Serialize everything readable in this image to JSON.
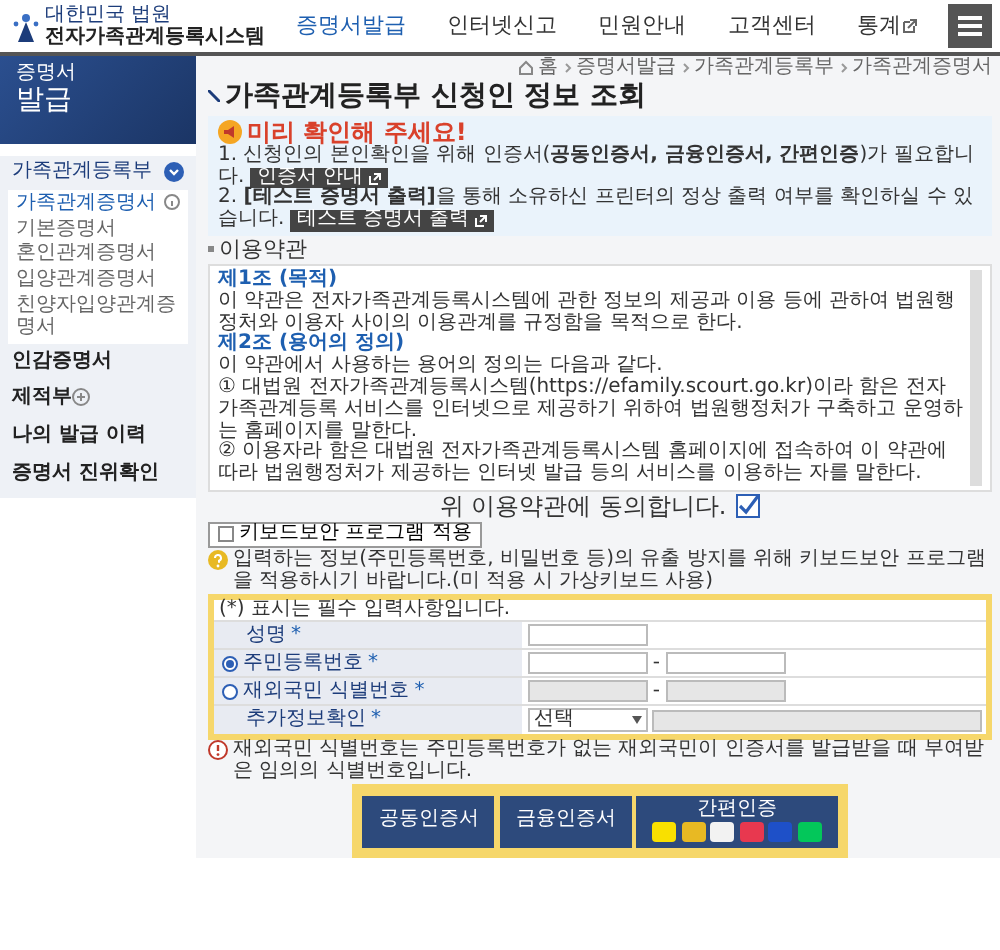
{
  "header": {
    "logo_top": "대한민국 법원",
    "logo_name": "전자가족관계등록시스템",
    "nav": [
      {
        "label": "증명서발급",
        "selected": true,
        "external": false
      },
      {
        "label": "인터넷신고",
        "selected": false,
        "external": false
      },
      {
        "label": "민원안내",
        "selected": false,
        "external": false
      },
      {
        "label": "고객센터",
        "selected": false,
        "external": false
      },
      {
        "label": "통계",
        "selected": false,
        "external": true
      }
    ]
  },
  "sidebar": {
    "banner_small": "증명서",
    "banner_large": "발급",
    "items": [
      {
        "kind": "group",
        "label": "가족관계등록부",
        "expanded": true,
        "children": [
          {
            "label": "가족관계증명서",
            "selected": true
          },
          {
            "label": "기본증명서",
            "selected": false
          },
          {
            "label": "혼인관계증명서",
            "selected": false
          },
          {
            "label": "입양관계증명서",
            "selected": false
          },
          {
            "label": "친양자입양관계증명서",
            "selected": false
          }
        ]
      },
      {
        "kind": "link",
        "label": "인감증명서"
      },
      {
        "kind": "group",
        "label": "제적부",
        "expanded": false
      },
      {
        "kind": "link",
        "label": "나의 발급 이력"
      },
      {
        "kind": "link",
        "label": "증명서 진위확인"
      }
    ]
  },
  "breadcrumb": [
    "홈",
    "증명서발급",
    "가족관계등록부",
    "가족관계증명서"
  ],
  "page_title": "가족관계등록부 신청인 정보 조회",
  "notice": {
    "title": "미리 확인해 주세요!",
    "lines": [
      {
        "text": "1. 신청인의 본인확인을 위해 인증서(**공동인증서, 금융인증서, 간편인증**)가 필요합니다.",
        "button": "인증서 안내"
      },
      {
        "text": "2. **[테스트 증명서 출력]**을 통해 소유하신 프린터의 정상 출력 여부를 확인하실 수 있습니다.",
        "button": "테스트 증명서 출력"
      }
    ]
  },
  "terms": {
    "heading": "이용약관",
    "articles": [
      {
        "title": "제1조 (목적)",
        "paragraphs": [
          "이 약관은 전자가족관계등록시스템에 관한 정보의 제공과 이용 등에 관하여 법원행정처와 이용자 사이의 이용관계를 규정함을 목적으로 한다."
        ]
      },
      {
        "title": "제2조 (용어의 정의)",
        "paragraphs": [
          "이 약관에서 사용하는 용어의 정의는 다음과 같다.",
          "① 대법원 전자가족관계등록시스템(https://efamily.scourt.go.kr)이라 함은 전자가족관계등록 서비스를 인터넷으로 제공하기 위하여 법원행정처가 구축하고 운영하는 홈페이지를 말한다.",
          "② 이용자라 함은 대법원 전자가족관계등록시스템 홈페이지에 접속하여 이 약관에 따라 법원행정처가 제공하는 인터넷 발급 등의 서비스를 이용하는 자를 말한다."
        ]
      }
    ]
  },
  "agree": {
    "label": "위 이용약관에 동의합니다.",
    "checked": true
  },
  "keyboard_security": {
    "label": "키보드보안 프로그램 적용",
    "checked": false,
    "note": "입력하는 정보(주민등록번호, 비밀번호 등)의 유출 방지를 위해 키보드보안 프로그램을 적용하시기 바랍니다.(미 적용 시 가상키보드 사용)"
  },
  "form": {
    "required_note": "(*) 표시는 필수 입력사항입니다.",
    "rows": [
      {
        "kind": "text",
        "label": "성명",
        "required_mark": "*"
      },
      {
        "kind": "split",
        "label": "주민등록번호",
        "required_mark": "*",
        "selected": true,
        "separator": "-"
      },
      {
        "kind": "split",
        "label": "재외국민 식별번호",
        "required_mark": "*",
        "selected": false,
        "separator": "-"
      },
      {
        "kind": "select",
        "label": "추가정보확인",
        "required_mark": "*",
        "value": "선택"
      }
    ]
  },
  "footnote": "재외국민 식별번호는 주민등록번호가 없는 재외국민이 인증서를 발급받을 때 부여받은 임의의 식별번호입니다.",
  "auth_buttons": [
    {
      "kind": "text",
      "label": "공동인증서"
    },
    {
      "kind": "text",
      "label": "금융인증서"
    },
    {
      "kind": "apps",
      "label": "간편인증",
      "apps": [
        {
          "color": "#f9e000"
        },
        {
          "color": "#e8b923"
        },
        {
          "color": "#f2f2f2"
        },
        {
          "color": "#e8384f"
        },
        {
          "color": "#1e50c8"
        },
        {
          "color": "#03c75a"
        }
      ]
    }
  ]
}
